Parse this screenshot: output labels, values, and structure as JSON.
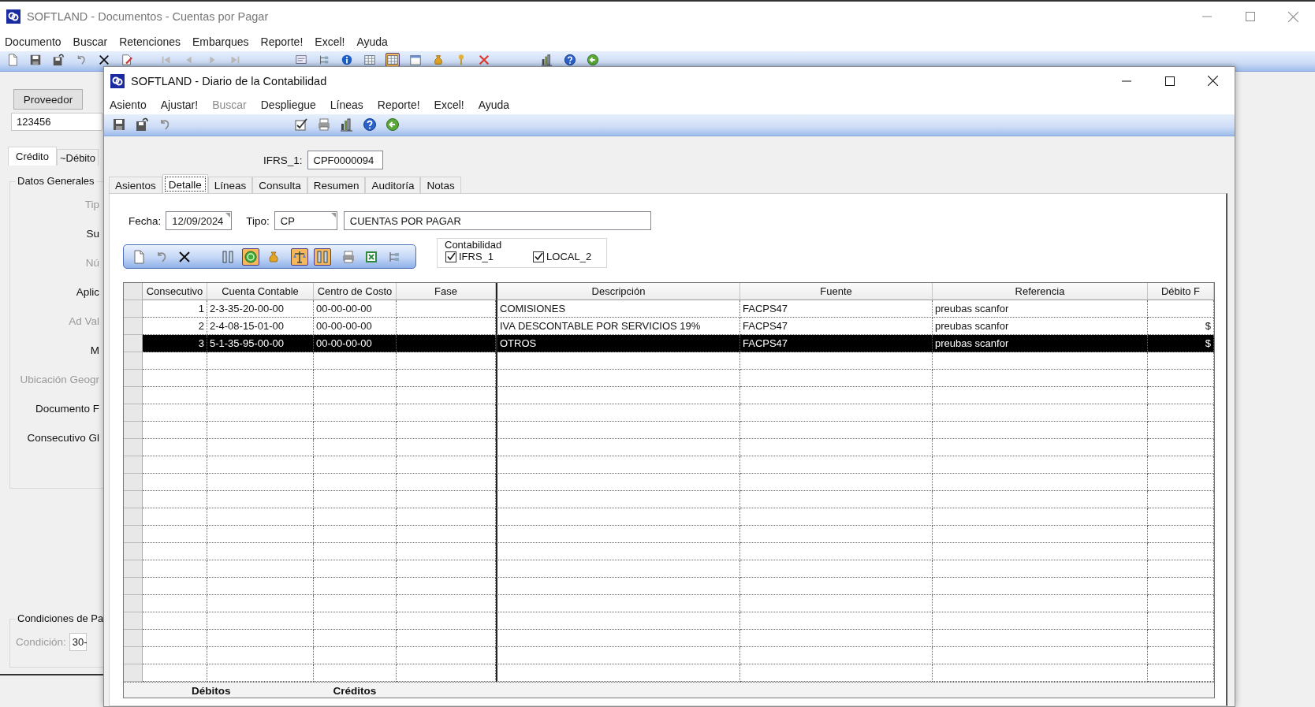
{
  "back_window": {
    "title": "SOFTLAND - Documentos - Cuentas por Pagar",
    "menu": [
      "Documento",
      "Buscar",
      "Retenciones",
      "Embarques",
      "Reporte!",
      "Excel!",
      "Ayuda"
    ],
    "toolbar": [
      [
        {
          "kind": "new",
          "pressed": false
        },
        {
          "kind": "save",
          "pressed": false
        },
        {
          "kind": "save-as",
          "pressed": false
        },
        {
          "kind": "undo",
          "pressed": false
        },
        {
          "kind": "delete",
          "pressed": false
        },
        {
          "kind": "doc-edit",
          "pressed": false
        }
      ],
      [
        {
          "kind": "first",
          "pressed": false
        },
        {
          "kind": "prev",
          "pressed": false
        },
        {
          "kind": "next",
          "pressed": false
        },
        {
          "kind": "last",
          "pressed": false
        }
      ],
      [
        {
          "kind": "note",
          "pressed": false
        },
        {
          "kind": "tree",
          "pressed": false
        },
        {
          "kind": "info",
          "pressed": false
        },
        {
          "kind": "table",
          "pressed": false
        },
        {
          "kind": "table",
          "pressed": true
        },
        {
          "kind": "calendar",
          "pressed": false
        },
        {
          "kind": "bag",
          "pressed": false
        },
        {
          "kind": "key",
          "pressed": false
        },
        {
          "kind": "red-x",
          "pressed": false
        }
      ],
      [
        {
          "kind": "bars",
          "pressed": false
        },
        {
          "kind": "help",
          "pressed": false
        },
        {
          "kind": "back",
          "pressed": false
        }
      ]
    ],
    "provider_button": "Proveedor",
    "provider_field": "123456",
    "tabs": [
      {
        "label": "Crédito",
        "selected": true
      },
      {
        "label": "~Débito",
        "selected": false
      }
    ],
    "general_group": {
      "legend": "Datos Generales",
      "labels": [
        {
          "text": "Tip",
          "disabled": true
        },
        {
          "text": "Su",
          "disabled": false
        },
        {
          "text": "Nú",
          "disabled": true
        },
        {
          "text": "Aplic",
          "disabled": false
        },
        {
          "text": "Ad Val",
          "disabled": true
        },
        {
          "text": "M",
          "disabled": false
        },
        {
          "text": "Ubicación Geogr",
          "disabled": true
        },
        {
          "text": "Documento F",
          "disabled": false
        },
        {
          "text": "Consecutivo Gl",
          "disabled": false
        }
      ]
    },
    "conditions_group": {
      "legend": "Condiciones de Pa",
      "label": "Condición:",
      "value": "30-"
    }
  },
  "window": {
    "title": "SOFTLAND - Diario de la Contabilidad",
    "menu": [
      {
        "label": "Asiento",
        "disabled": false
      },
      {
        "label": "Ajustar!",
        "disabled": false
      },
      {
        "label": "Buscar",
        "disabled": true
      },
      {
        "label": "Despliegue",
        "disabled": false
      },
      {
        "label": "Líneas",
        "disabled": false
      },
      {
        "label": "Reporte!",
        "disabled": false
      },
      {
        "label": "Excel!",
        "disabled": false
      },
      {
        "label": "Ayuda",
        "disabled": false
      }
    ],
    "toolbar": [
      [
        {
          "kind": "save",
          "pressed": false
        },
        {
          "kind": "save-as",
          "pressed": false
        },
        {
          "kind": "undo",
          "pressed": false
        }
      ],
      [
        {
          "kind": "check-edit",
          "pressed": false
        },
        {
          "kind": "print",
          "pressed": false
        },
        {
          "kind": "bars",
          "pressed": false
        },
        {
          "kind": "help",
          "pressed": false
        },
        {
          "kind": "back",
          "pressed": false
        }
      ]
    ],
    "ifrs": {
      "label": "IFRS_1:",
      "value": "CPF0000094"
    },
    "tabs": [
      {
        "label": "Asientos",
        "selected": false
      },
      {
        "label": "Detalle",
        "selected": true
      },
      {
        "label": "Líneas",
        "selected": false
      },
      {
        "label": "Consulta",
        "selected": false
      },
      {
        "label": "Resumen",
        "selected": false
      },
      {
        "label": "Auditoría",
        "selected": false
      },
      {
        "label": "Notas",
        "selected": false
      }
    ],
    "fecha": {
      "label": "Fecha:",
      "value": "12/09/2024"
    },
    "tipo": {
      "label": "Tipo:",
      "value": "CP",
      "description": "CUENTAS POR PAGAR"
    },
    "grid_toolbar": [
      [
        {
          "kind": "new",
          "pressed": false
        },
        {
          "kind": "undo",
          "pressed": false
        },
        {
          "kind": "delete",
          "pressed": false
        }
      ],
      [
        {
          "kind": "columns",
          "pressed": false
        },
        {
          "kind": "refresh",
          "pressed": true
        },
        {
          "kind": "bag",
          "pressed": false
        }
      ],
      [
        {
          "kind": "scales",
          "pressed": true
        },
        {
          "kind": "columns",
          "pressed": true
        }
      ],
      [
        {
          "kind": "print",
          "pressed": false
        },
        {
          "kind": "excel",
          "pressed": false
        },
        {
          "kind": "tree",
          "pressed": false
        }
      ]
    ],
    "contabilidad": {
      "legend": "Contabilidad",
      "options": [
        {
          "label": "IFRS_1",
          "checked": true
        },
        {
          "label": "LOCAL_2",
          "checked": true
        }
      ]
    },
    "table": {
      "columns": [
        "Consecutivo",
        "Cuenta Contable",
        "Centro de Costo",
        "Fase",
        "Descripción",
        "Fuente",
        "Referencia",
        "Débito F"
      ],
      "rows": [
        {
          "cells": [
            "1",
            "2-3-35-20-00-00",
            "00-00-00-00",
            null,
            "COMISIONES",
            "FACPS47",
            "preubas scanfor",
            null
          ],
          "selected": false
        },
        {
          "cells": [
            "2",
            "2-4-08-15-01-00",
            "00-00-00-00",
            null,
            "IVA DESCONTABLE POR SERVICIOS 19%",
            "FACPS47",
            "preubas scanfor",
            "$"
          ],
          "selected": false
        },
        {
          "cells": [
            "3",
            "5-1-35-95-00-00",
            "00-00-00-00",
            null,
            "OTROS",
            "FACPS47",
            "preubas scanfor",
            "$"
          ],
          "selected": true
        }
      ]
    },
    "totals": [
      "Débitos",
      "Créditos"
    ]
  }
}
